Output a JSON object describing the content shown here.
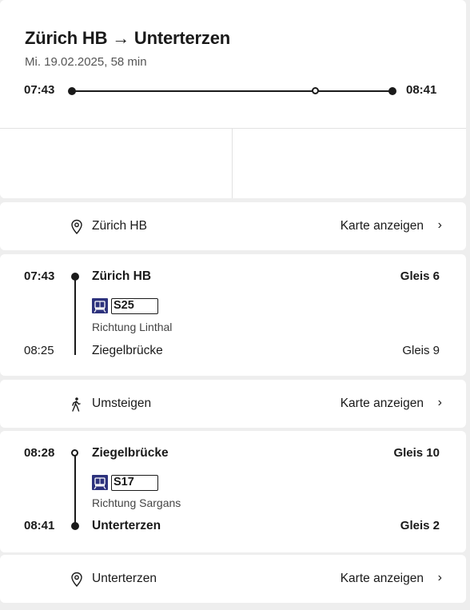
{
  "header": {
    "title": "Zürich HB → Unterterzen",
    "subtitle": "Mi. 19.02.2025, 58 min",
    "departure_time": "07:43",
    "arrival_time": "08:41"
  },
  "start_location": {
    "name": "Zürich HB",
    "map_link": "Karte anzeigen",
    "icon": "map-pin-icon"
  },
  "leg1": {
    "dep_time": "07:43",
    "dep_stop": "Zürich HB",
    "dep_platform": "Gleis 6",
    "line": "S25",
    "direction": "Richtung Linthal",
    "arr_time": "08:25",
    "arr_stop": "Ziegelbrücke",
    "arr_platform": "Gleis 9",
    "icon": "train-icon"
  },
  "transfer": {
    "label": "Umsteigen",
    "map_link": "Karte anzeigen",
    "icon": "walking-person-icon"
  },
  "leg2": {
    "dep_time": "08:28",
    "dep_stop": "Ziegelbrücke",
    "dep_platform": "Gleis 10",
    "line": "S17",
    "direction": "Richtung Sargans",
    "arr_time": "08:41",
    "arr_stop": "Unterterzen",
    "arr_platform": "Gleis 2",
    "icon": "train-icon"
  },
  "end_location": {
    "name": "Unterterzen",
    "map_link": "Karte anzeigen",
    "icon": "map-pin-icon"
  },
  "colors": {
    "text": "#1a1a1a",
    "train_icon_bg": "#2d327d",
    "background": "#eeeeee"
  }
}
